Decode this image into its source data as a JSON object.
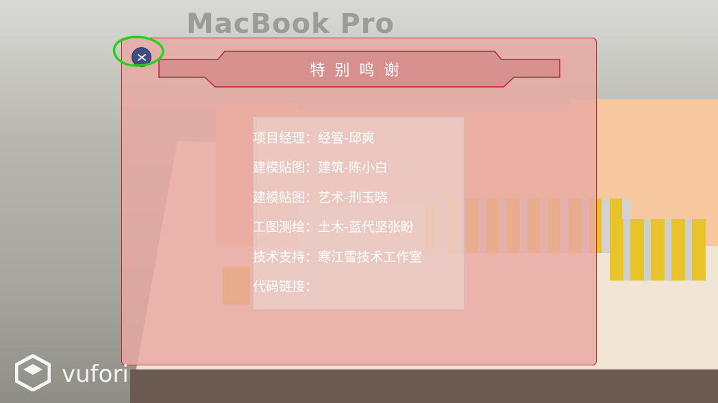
{
  "background": {
    "laptop_text": "MacBook Pro",
    "watermark_text": "vufori"
  },
  "dialog": {
    "title": "特别鸣谢",
    "close_icon": "close-icon",
    "credits": [
      {
        "role": "项目经理",
        "sep": "：",
        "value": "经管-邱爽"
      },
      {
        "role": "建模贴图",
        "sep": "：",
        "value": "建筑-陈小白"
      },
      {
        "role": "建模贴图",
        "sep": "：",
        "value": "艺术-刑玉晓"
      },
      {
        "role": "工图测绘",
        "sep": "：",
        "value": "土木-蓝代坚张盼"
      },
      {
        "role": "技术支持",
        "sep": "：",
        "value": "寒江雪技术工作室"
      },
      {
        "role": "代码链接",
        "sep": "：",
        "value": ""
      }
    ]
  },
  "colors": {
    "dialog_border": "#c41f2b",
    "dialog_fill": "#e8a8a2",
    "close_button": "#3e4e82",
    "annotation": "#22d31a"
  }
}
